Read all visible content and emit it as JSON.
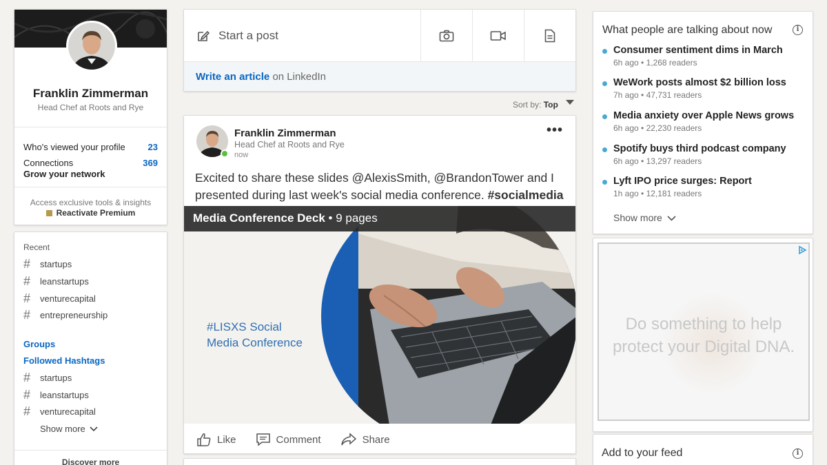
{
  "profile": {
    "name": "Franklin Zimmerman",
    "title": "Head Chef at Roots and Rye",
    "who_viewed_label": "Who's viewed your profile",
    "who_viewed_count": "23",
    "connections_label": "Connections",
    "connections_count": "369",
    "grow_label": "Grow your network",
    "premium_line": "Access exclusive tools & insights",
    "premium_cta": "Reactivate Premium"
  },
  "community": {
    "recent_label": "Recent",
    "recent_tags": [
      "startups",
      "leanstartups",
      "venturecapital",
      "entrepreneurship"
    ],
    "groups_label": "Groups",
    "followed_label": "Followed Hashtags",
    "followed_tags": [
      "startups",
      "leanstartups",
      "venturecapital"
    ],
    "show_more": "Show more",
    "discover": "Discover more"
  },
  "share": {
    "start_post": "Start a post",
    "write_article": "Write an article",
    "write_suffix": "on LinkedIn"
  },
  "sort": {
    "label": "Sort by:",
    "value": "Top"
  },
  "post": {
    "author": "Franklin Zimmerman",
    "title": "Head Chef at Roots and Rye",
    "time": "now",
    "text_main": "Excited to share these slides @AlexisSmith, @BrandonTower and I presented during last week's social media conference.",
    "hashtag": "#socialmedia",
    "doc_title": "Media Conference Deck",
    "doc_pages": "• 9 pages",
    "doc_tag_line1": "#LISXS Social",
    "doc_tag_line2": "Media Conference",
    "like": "Like",
    "comment": "Comment",
    "share": "Share"
  },
  "news": {
    "heading": "What people are talking about now",
    "items": [
      {
        "title": "Consumer sentiment dims in March",
        "meta": "6h ago • 1,268 readers"
      },
      {
        "title": "WeWork posts almost $2 billion loss",
        "meta": "7h ago • 47,731 readers"
      },
      {
        "title": "Media anxiety over Apple News grows",
        "meta": "6h ago • 22,230 readers"
      },
      {
        "title": "Spotify buys third podcast company",
        "meta": "6h ago • 13,297 readers"
      },
      {
        "title": "Lyft IPO price surges: Report",
        "meta": "1h ago • 12,181 readers"
      }
    ],
    "show_more": "Show more"
  },
  "ad": {
    "line1": "Do something to help",
    "line2": "protect your Digital DNA."
  },
  "feed": {
    "heading": "Add to your feed"
  },
  "colors": {
    "accent": "#0a66c2",
    "news_dot": "#49a9d6",
    "online": "#5bbf3b"
  }
}
